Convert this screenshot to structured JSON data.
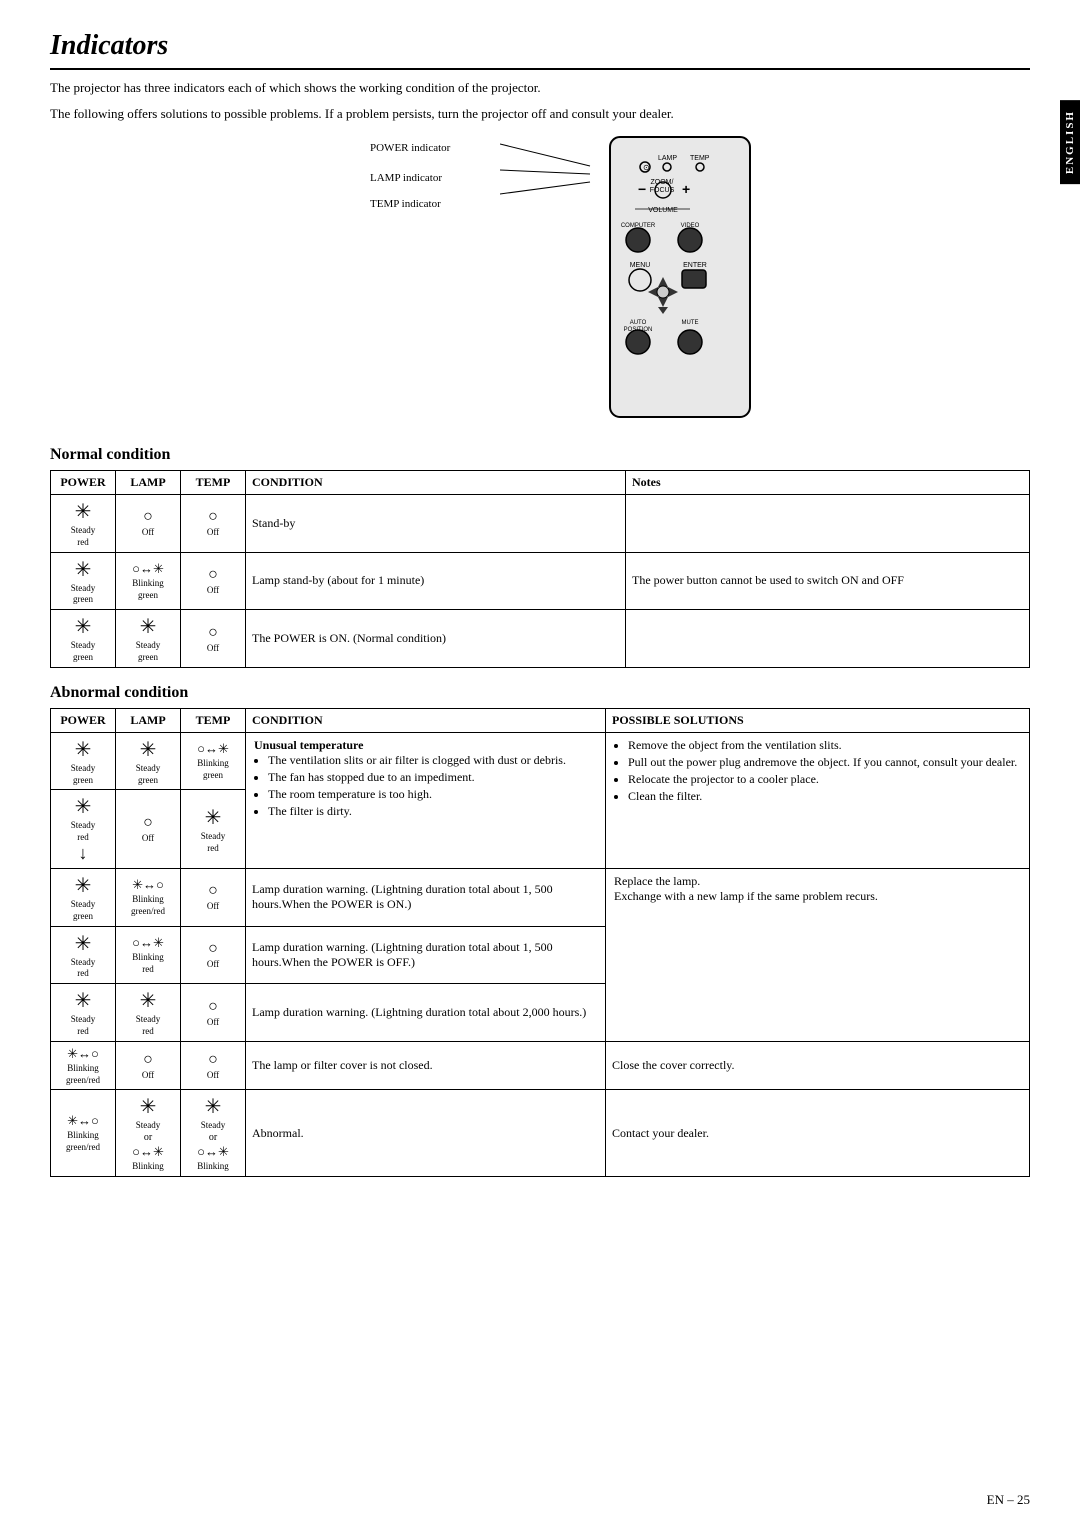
{
  "page": {
    "title": "Indicators",
    "side_label": "ENGLISH",
    "page_number": "EN – 25",
    "intro1": "The projector has three indicators each of which shows the working condition of the projector.",
    "intro2": "The following offers solutions to possible problems. If a problem persists, turn the projector off and consult your dealer.",
    "indicators": {
      "power": "POWER indicator",
      "lamp": "LAMP indicator",
      "temp": "TEMP indicator"
    },
    "normal_condition": {
      "title": "Normal condition",
      "headers": {
        "power": "POWER",
        "lamp": "LAMP",
        "temp": "TEMP",
        "condition": "CONDITION",
        "notes": "Notes"
      },
      "rows": [
        {
          "power": {
            "symbol": "sun",
            "label1": "Steady",
            "label2": "red"
          },
          "lamp": {
            "symbol": "circle_off",
            "label1": "Off",
            "label2": ""
          },
          "temp": {
            "symbol": "circle_off",
            "label1": "Off",
            "label2": ""
          },
          "condition": "Stand-by",
          "notes": ""
        },
        {
          "power": {
            "symbol": "sun",
            "label1": "Steady",
            "label2": "green"
          },
          "lamp": {
            "symbol": "blink_sun",
            "label1": "Blinking",
            "label2": "green"
          },
          "temp": {
            "symbol": "circle_off",
            "label1": "Off",
            "label2": ""
          },
          "condition": "Lamp stand-by (about for 1 minute)",
          "notes": "The power button cannot be used to switch ON and OFF"
        },
        {
          "power": {
            "symbol": "sun",
            "label1": "Steady",
            "label2": "green"
          },
          "lamp": {
            "symbol": "sun",
            "label1": "Steady",
            "label2": "green"
          },
          "temp": {
            "symbol": "circle_off",
            "label1": "Off",
            "label2": ""
          },
          "condition": "The POWER is ON. (Normal condition)",
          "notes": ""
        }
      ]
    },
    "abnormal_condition": {
      "title": "Abnormal condition",
      "headers": {
        "power": "POWER",
        "lamp": "LAMP",
        "temp": "TEMP",
        "condition": "CONDITION",
        "solutions": "POSSIBLE SOLUTIONS"
      },
      "rows": [
        {
          "power_rows": [
            {
              "symbol": "sun",
              "label1": "Steady",
              "label2": "green"
            },
            {
              "symbol": "sun",
              "label1": "Steady",
              "label2": "red"
            }
          ],
          "lamp_rows": [
            {
              "symbol": "sun",
              "label1": "Steady",
              "label2": "green"
            },
            {
              "symbol": "circle_off",
              "label1": "Off",
              "label2": ""
            }
          ],
          "temp_rows": [
            {
              "symbol": "blink_sun",
              "label1": "Blinking",
              "label2": "green"
            },
            {
              "symbol": "sun",
              "label1": "Steady",
              "label2": "red"
            }
          ],
          "condition_title": "Unusual temperature",
          "condition_items": [
            "The ventilation slits or air filter is clogged with dust or debris.",
            "The fan has stopped due to an impediment.",
            "The room temperature is too high.",
            "The filter is dirty."
          ],
          "solutions": [
            "Remove the object from the ventilation slits.",
            "Pull out the power plug andremove the object. If you cannot, consult your dealer.",
            "Relocate the projector to a cooler place.",
            "Clean the filter."
          ]
        },
        {
          "power_rows": [
            {
              "symbol": "sun",
              "label1": "Steady",
              "label2": "green"
            }
          ],
          "lamp_rows": [
            {
              "symbol": "blink_sun_red",
              "label1": "Blinking",
              "label2": "green/red"
            }
          ],
          "temp_rows": [
            {
              "symbol": "circle_off",
              "label1": "Off",
              "label2": ""
            }
          ],
          "condition": "Lamp duration warning. (Lightning duration total about 1, 500 hours.When the POWER is ON.)",
          "solutions_merged": "Replace the lamp.\nExchange with a new lamp if the same problem recurs."
        },
        {
          "power_rows": [
            {
              "symbol": "sun",
              "label1": "Steady",
              "label2": "red"
            }
          ],
          "lamp_rows": [
            {
              "symbol": "blink_sun",
              "label1": "Blinking",
              "label2": "red"
            }
          ],
          "temp_rows": [
            {
              "symbol": "circle_off",
              "label1": "Off",
              "label2": ""
            }
          ],
          "condition": "Lamp duration warning. (Lightning duration total about 1, 500 hours.When the POWER is OFF.)",
          "solutions_merged": null
        },
        {
          "power_rows": [
            {
              "symbol": "sun",
              "label1": "Steady",
              "label2": "red"
            }
          ],
          "lamp_rows": [
            {
              "symbol": "sun",
              "label1": "Steady",
              "label2": "red"
            }
          ],
          "temp_rows": [
            {
              "symbol": "circle_off",
              "label1": "Off",
              "label2": ""
            }
          ],
          "condition": "Lamp duration warning. (Lightning duration total about 2,000 hours.)",
          "solutions_merged": null
        },
        {
          "power_rows": [
            {
              "symbol": "blink_sun_greenred",
              "label1": "Blinking",
              "label2": "green/red"
            }
          ],
          "lamp_rows": [
            {
              "symbol": "circle_off",
              "label1": "Off",
              "label2": ""
            }
          ],
          "temp_rows": [
            {
              "symbol": "circle_off",
              "label1": "Off",
              "label2": ""
            }
          ],
          "condition": "The lamp or filter cover is not closed.",
          "solutions_single": "Close the cover correctly."
        },
        {
          "power_rows": [
            {
              "symbol": "blink_sun_greenred",
              "label1": "Blinking",
              "label2": "green/red"
            }
          ],
          "lamp_rows": [
            {
              "symbol": "sun",
              "label1": "Steady",
              "label2": ""
            },
            {
              "symbol": "blink_sun",
              "label1": "or",
              "label2": ""
            },
            {
              "symbol": "blink_circle",
              "label1": "Blinking",
              "label2": ""
            }
          ],
          "temp_rows": [
            {
              "symbol": "sun",
              "label1": "Steady",
              "label2": ""
            },
            {
              "symbol": "blink_sun",
              "label1": "or",
              "label2": ""
            },
            {
              "symbol": "blink_circle",
              "label1": "Blinking",
              "label2": ""
            }
          ],
          "condition": "Abnormal.",
          "solutions_single": "Contact your dealer."
        }
      ]
    }
  }
}
